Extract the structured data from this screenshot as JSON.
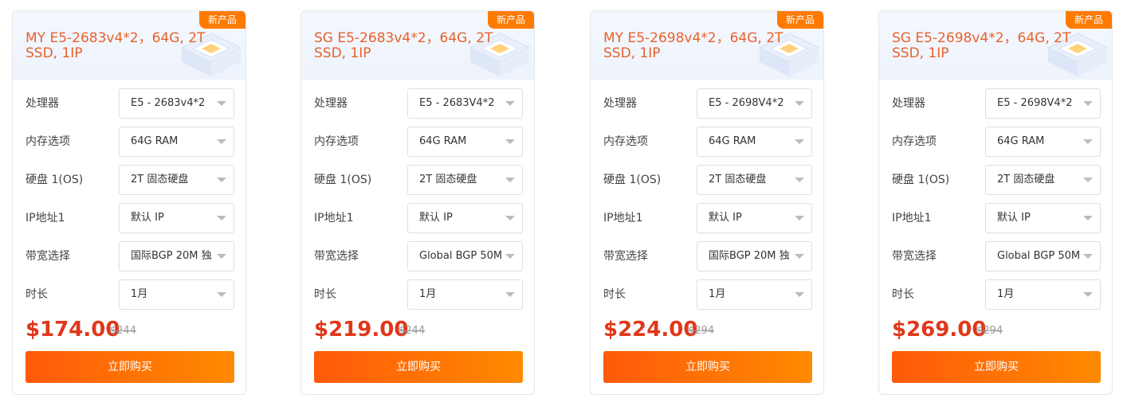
{
  "cards": [
    {
      "badge": "新产品",
      "title": "MY E5-2683v4*2，64G, 2T SSD, 1IP",
      "options": [
        {
          "label": "处理器",
          "value": "E5 - 2683v4*2"
        },
        {
          "label": "内存选项",
          "value": "64G RAM"
        },
        {
          "label": "硬盘 1(OS)",
          "value": "2T 固态硬盘"
        },
        {
          "label": "IP地址1",
          "value": "默认 IP"
        },
        {
          "label": "带宽选择",
          "value": "国际BGP 20M 独"
        },
        {
          "label": "时长",
          "value": "1月"
        }
      ],
      "price": "$174.00",
      "original_price": "$244",
      "buy_label": "立即购买"
    },
    {
      "badge": "新产品",
      "title": "SG E5-2683v4*2，64G, 2T SSD, 1IP",
      "options": [
        {
          "label": "处理器",
          "value": "E5 - 2683V4*2"
        },
        {
          "label": "内存选项",
          "value": "64G RAM"
        },
        {
          "label": "硬盘 1(OS)",
          "value": "2T 固态硬盘"
        },
        {
          "label": "IP地址1",
          "value": "默认 IP"
        },
        {
          "label": "带宽选择",
          "value": "Global BGP 50M"
        },
        {
          "label": "时长",
          "value": "1月"
        }
      ],
      "price": "$219.00",
      "original_price": "$244",
      "buy_label": "立即购买"
    },
    {
      "badge": "新产品",
      "title": "MY E5-2698v4*2，64G, 2T SSD, 1IP",
      "options": [
        {
          "label": "处理器",
          "value": "E5 - 2698V4*2"
        },
        {
          "label": "内存选项",
          "value": "64G RAM"
        },
        {
          "label": "硬盘 1(OS)",
          "value": "2T 固态硬盘"
        },
        {
          "label": "IP地址1",
          "value": "默认 IP"
        },
        {
          "label": "带宽选择",
          "value": "国际BGP 20M 独"
        },
        {
          "label": "时长",
          "value": "1月"
        }
      ],
      "price": "$224.00",
      "original_price": "$294",
      "buy_label": "立即购买"
    },
    {
      "badge": "新产品",
      "title": "SG E5-2698v4*2，64G, 2T SSD, 1IP",
      "options": [
        {
          "label": "处理器",
          "value": "E5 - 2698V4*2"
        },
        {
          "label": "内存选项",
          "value": "64G RAM"
        },
        {
          "label": "硬盘 1(OS)",
          "value": "2T 固态硬盘"
        },
        {
          "label": "IP地址1",
          "value": "默认 IP"
        },
        {
          "label": "带宽选择",
          "value": "Global BGP 50M"
        },
        {
          "label": "时长",
          "value": "1月"
        }
      ],
      "price": "$269.00",
      "original_price": "$294",
      "buy_label": "立即购买"
    }
  ],
  "colors": {
    "badge": "#ff7a00",
    "title": "#e8612c",
    "price": "#e0371a",
    "button_start": "#ff5a0a",
    "button_end": "#ff8a00"
  }
}
